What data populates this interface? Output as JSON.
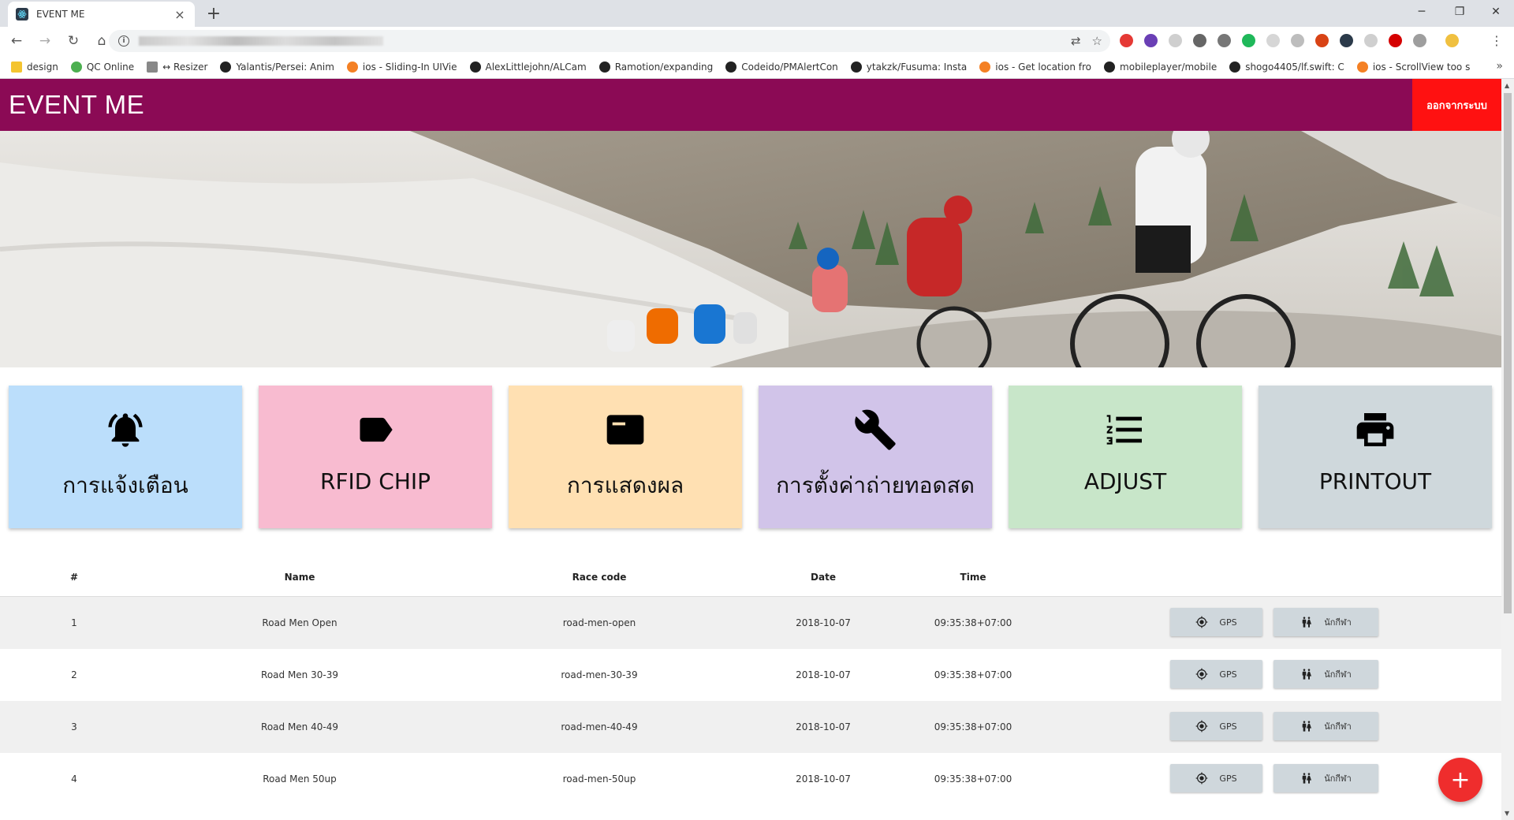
{
  "browser": {
    "tab_title": "EVENT ME",
    "bookmarks": [
      {
        "label": "design",
        "icon": "folder-icon",
        "color": "#f4c430"
      },
      {
        "label": "QC Online",
        "icon": "check-icon",
        "color": "#4caf50"
      },
      {
        "label": "↔ Resizer",
        "icon": "page-icon",
        "color": "#888888"
      },
      {
        "label": "Yalantis/Persei: Anim",
        "icon": "github-icon",
        "color": "#222222"
      },
      {
        "label": "ios - Sliding-In UIVie",
        "icon": "stackoverflow-icon",
        "color": "#f48024"
      },
      {
        "label": "AlexLittlejohn/ALCam",
        "icon": "github-icon",
        "color": "#222222"
      },
      {
        "label": "Ramotion/expanding",
        "icon": "github-icon",
        "color": "#222222"
      },
      {
        "label": "Codeido/PMAlertCon",
        "icon": "github-icon",
        "color": "#222222"
      },
      {
        "label": "ytakzk/Fusuma: Insta",
        "icon": "github-icon",
        "color": "#222222"
      },
      {
        "label": "ios - Get location fro",
        "icon": "stackoverflow-icon",
        "color": "#f48024"
      },
      {
        "label": "mobileplayer/mobile",
        "icon": "github-icon",
        "color": "#222222"
      },
      {
        "label": "shogo4405/lf.swift: C",
        "icon": "github-icon",
        "color": "#222222"
      },
      {
        "label": "ios - ScrollView too s",
        "icon": "stackoverflow-icon",
        "color": "#f48024"
      }
    ]
  },
  "app": {
    "title": "EVENT ME",
    "logout_label": "ออกจากระบบ"
  },
  "cards": [
    {
      "label": "การแจ้งเตือน",
      "icon": "bell-icon",
      "color": "#bbdefb"
    },
    {
      "label": "RFID CHIP",
      "icon": "label-tag-icon",
      "color": "#f8bbd0"
    },
    {
      "label": "การแสดงผล",
      "icon": "display-card-icon",
      "color": "#ffe0b2"
    },
    {
      "label": "การตั้งค่าถ่ายทอดสด",
      "icon": "wrench-icon",
      "color": "#d1c4e9"
    },
    {
      "label": "ADJUST",
      "icon": "numbered-list-icon",
      "color": "#c8e6c9"
    },
    {
      "label": "PRINTOUT",
      "icon": "printer-icon",
      "color": "#cfd8dc"
    }
  ],
  "table": {
    "headers": {
      "num": "#",
      "name": "Name",
      "race_code": "Race code",
      "date": "Date",
      "time": "Time"
    },
    "rows": [
      {
        "num": "1",
        "name": "Road Men Open",
        "race_code": "road-men-open",
        "date": "2018-10-07",
        "time": "09:35:38+07:00",
        "gps_label": "GPS",
        "athlete_label": "นักกีฬา"
      },
      {
        "num": "2",
        "name": "Road Men 30-39",
        "race_code": "road-men-30-39",
        "date": "2018-10-07",
        "time": "09:35:38+07:00",
        "gps_label": "GPS",
        "athlete_label": "นักกีฬา"
      },
      {
        "num": "3",
        "name": "Road Men 40-49",
        "race_code": "road-men-40-49",
        "date": "2018-10-07",
        "time": "09:35:38+07:00",
        "gps_label": "GPS",
        "athlete_label": "นักกีฬา"
      },
      {
        "num": "4",
        "name": "Road Men 50up",
        "race_code": "road-men-50up",
        "date": "2018-10-07",
        "time": "09:35:38+07:00",
        "gps_label": "GPS",
        "athlete_label": "นักกีฬา"
      }
    ]
  },
  "fab": {
    "label": "+"
  },
  "colors": {
    "appbar": "#8b0a55",
    "logout": "#ff1111",
    "fab": "#ef2d2d"
  }
}
